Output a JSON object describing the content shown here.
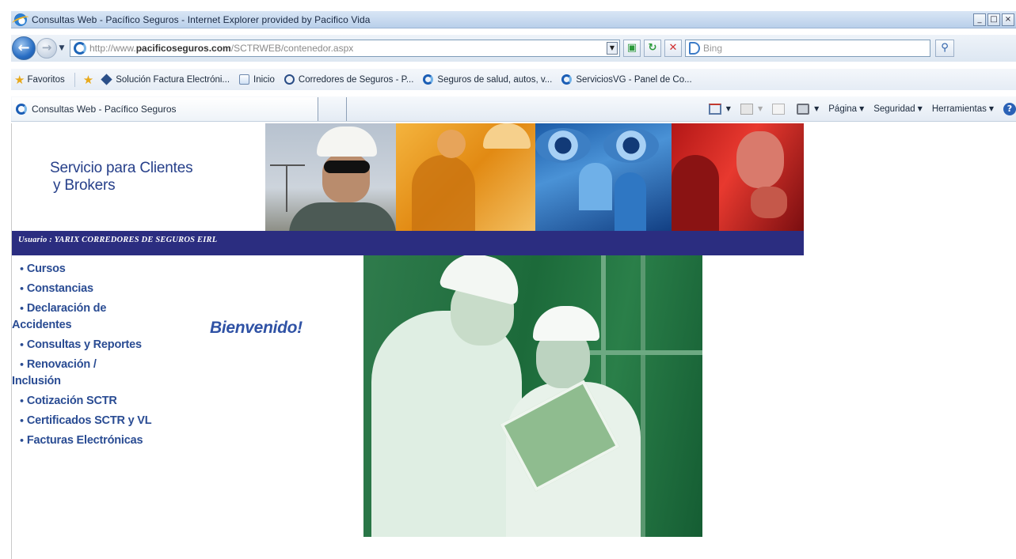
{
  "window": {
    "title": "Consultas Web - Pacífico Seguros - Internet Explorer provided by Pacifico Vida",
    "buttons": [
      "_",
      "□",
      "×"
    ]
  },
  "nav": {
    "url_prefix": "http://www.",
    "url_domain": "pacificoseguros.com",
    "url_path": "/SCTRWEB/contenedor.aspx",
    "search_placeholder": "Bing"
  },
  "favorites": {
    "label": "Favoritos",
    "items": [
      {
        "label": "Solución Factura Electróni...",
        "icon": "diamond-icon"
      },
      {
        "label": "Inicio",
        "icon": "page-icon"
      },
      {
        "label": "Corredores de Seguros - P...",
        "icon": "compass-icon"
      },
      {
        "label": "Seguros de salud, autos, v...",
        "icon": "pacifico-icon"
      },
      {
        "label": "ServiciosVG - Panel de Co...",
        "icon": "pacifico-icon"
      }
    ]
  },
  "tab": {
    "label": "Consultas Web - Pacífico Seguros"
  },
  "commands": {
    "page": "Página",
    "security": "Seguridad",
    "tools": "Herramientas"
  },
  "page": {
    "brand_line1": "Servicio para Clientes",
    "brand_line2": "y Brokers",
    "user_label": "Usuario : YARIX CORREDORES DE SEGUROS EIRL",
    "welcome": "Bienvenido!",
    "menu": [
      "Cursos",
      "Constancias",
      "Declaración de",
      "Accidentes",
      "Consultas y Reportes",
      "Renovación /",
      "Inclusión",
      "Cotización SCTR",
      "Certificados SCTR y VL",
      "Facturas Electrónicas"
    ]
  },
  "colors": {
    "brand_navy": "#2b2d80",
    "menu_blue": "#2a4c93",
    "hero_green": "#1c6a3a"
  }
}
